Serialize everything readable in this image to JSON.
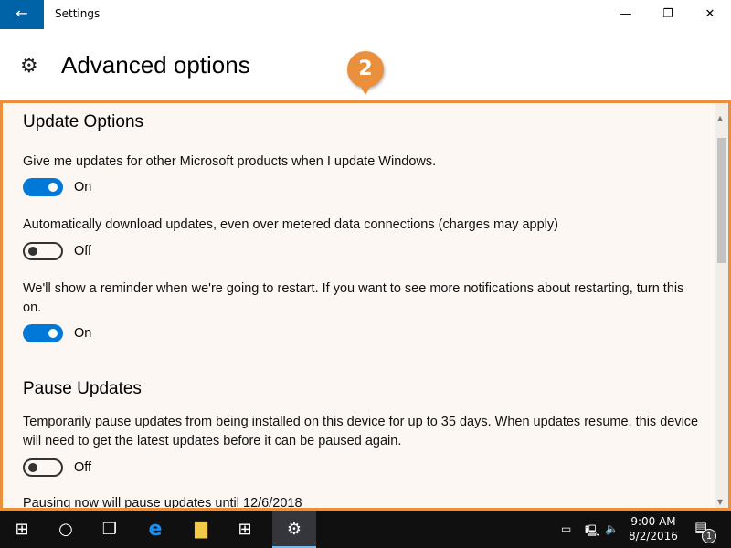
{
  "window": {
    "title": "Settings",
    "back_icon": "arrow-left-icon",
    "minimize": "—",
    "maximize": "❐",
    "close": "✕"
  },
  "header": {
    "title": "Advanced options",
    "icon": "gear-icon"
  },
  "callout": {
    "number": "2",
    "color": "#ea8f3c"
  },
  "sections": {
    "update": {
      "title": "Update Options",
      "items": [
        {
          "text": "Give me updates for other Microsoft products when I update Windows.",
          "state": "On"
        },
        {
          "text": "Automatically download updates, even over metered data connections (charges may apply)",
          "state": "Off"
        },
        {
          "text": "We'll show a reminder when we're going to restart. If you want to see more notifications about restarting, turn this on.",
          "state": "On"
        }
      ]
    },
    "pause": {
      "title": "Pause Updates",
      "text": "Temporarily pause updates from being installed on this device for up to 35 days. When updates resume, this device will need to get the latest updates before it can be paused again.",
      "state": "Off",
      "note": "Pausing now will pause updates until 12/6/2018"
    }
  },
  "taskbar": {
    "time": "9:00 AM",
    "date": "8/2/2016",
    "notifications": "1",
    "accent": "#0078d7"
  }
}
